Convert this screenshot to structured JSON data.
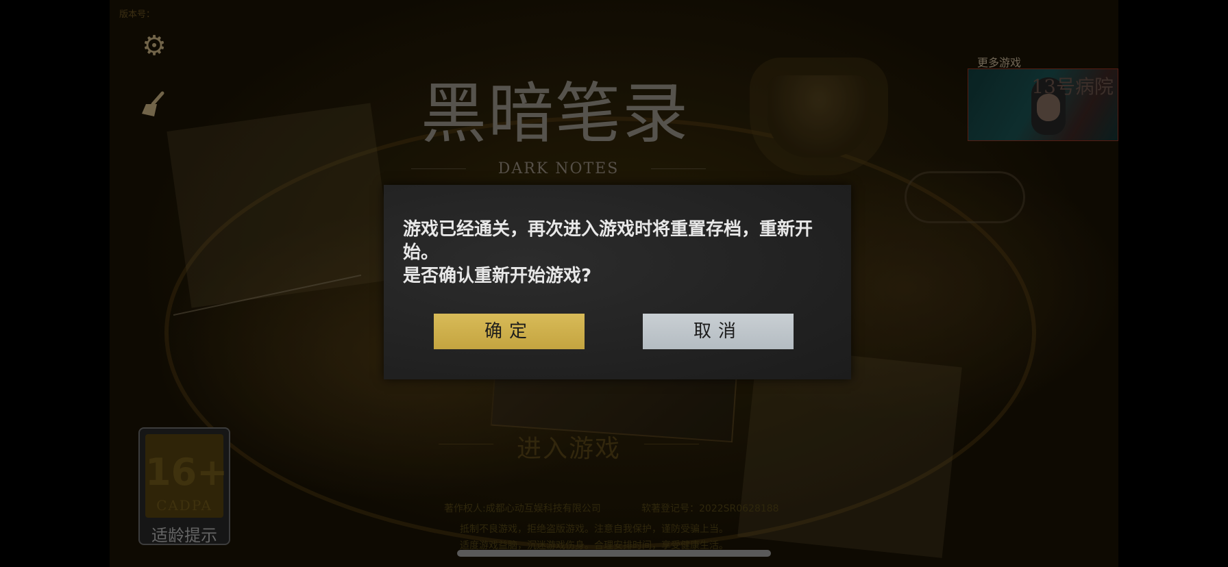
{
  "header": {
    "version_label": "版本号：",
    "version_value": ""
  },
  "icons": {
    "settings": "gear-icon",
    "clear_cache": "broom-icon"
  },
  "title": {
    "main": "黑暗笔录",
    "sub": "DARK NOTES"
  },
  "more_games": {
    "label": "更多游戏",
    "thumb_title": "13号病院"
  },
  "enter_game": "进入游戏",
  "rating": {
    "age": "16+",
    "org": "CADPA",
    "label": "适龄提示"
  },
  "footer": {
    "copyright": "著作权人:成都心动互娱科技有限公司",
    "registration": "软著登记号：2022SR0628188",
    "notice_line1": "抵制不良游戏，拒绝盗版游戏。注意自我保护，谨防受骗上当。",
    "notice_line2": "适度游戏益脑，沉迷游戏伤身。合理安排时间，享受健康生活。"
  },
  "dialog": {
    "line1": "游戏已经通关，再次进入游戏时将重置存档，重新开始。",
    "line2": "是否确认重新开始游戏?",
    "confirm_label": "确定",
    "cancel_label": "取消"
  },
  "colors": {
    "confirm_button": "#d2b450",
    "cancel_button": "#c2c9ce",
    "dialog_bg": "#262626"
  }
}
